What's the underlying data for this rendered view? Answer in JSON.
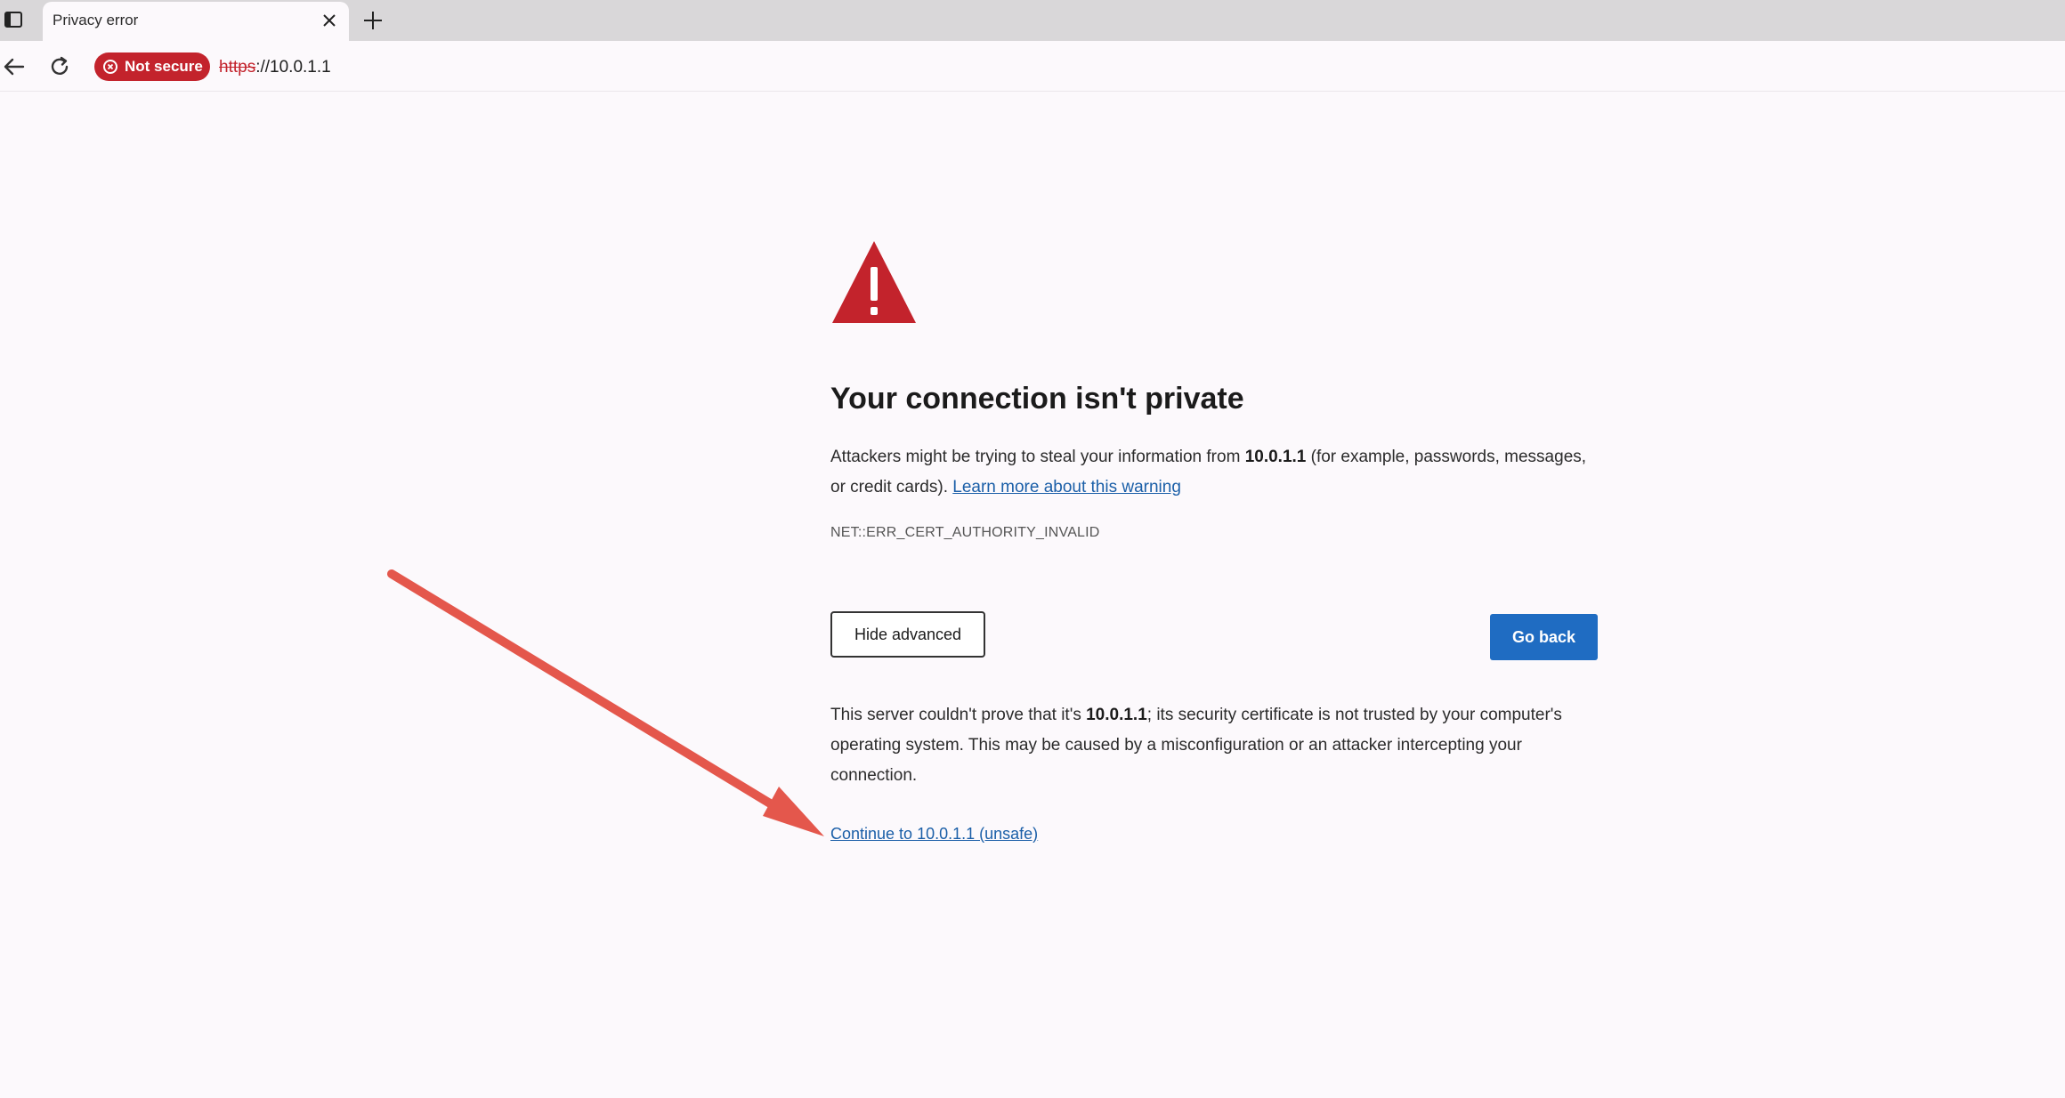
{
  "browser": {
    "tab_title": "Privacy error",
    "close_tab_glyph": "×",
    "new_tab_glyph": "+",
    "security_badge": "Not secure",
    "url_scheme": "https",
    "url_rest": "://10.0.1.1",
    "icons": [
      "window-icon",
      "close-icon",
      "plus-icon",
      "back-arrow-icon",
      "reload-icon",
      "not-secure-icon"
    ]
  },
  "page": {
    "heading": "Your connection isn't private",
    "intro_before_host": "Attackers might be trying to steal your information from ",
    "host": "10.0.1.1",
    "intro_after_host": " (for example, passwords, messages, or credit cards). ",
    "learn_more_link": "Learn more about this warning",
    "error_code": "NET::ERR_CERT_AUTHORITY_INVALID",
    "hide_advanced_button": "Hide advanced",
    "go_back_button": "Go back",
    "advanced_before_host": "This server couldn't prove that it's ",
    "advanced_host": "10.0.1.1",
    "advanced_after_host": "; its security certificate is not trusted by your computer's operating system. This may be caused by a misconfiguration or an attacker intercepting your connection.",
    "continue_link": "Continue to 10.0.1.1 (unsafe)"
  },
  "colors": {
    "page_background": "#fcf9fc",
    "tab_strip": "#d9d7d9",
    "danger_red": "#c3232c",
    "primary_blue": "#1f6cc2",
    "link_blue": "#1b5fa8",
    "annotation_arrow": "#e4574c"
  }
}
